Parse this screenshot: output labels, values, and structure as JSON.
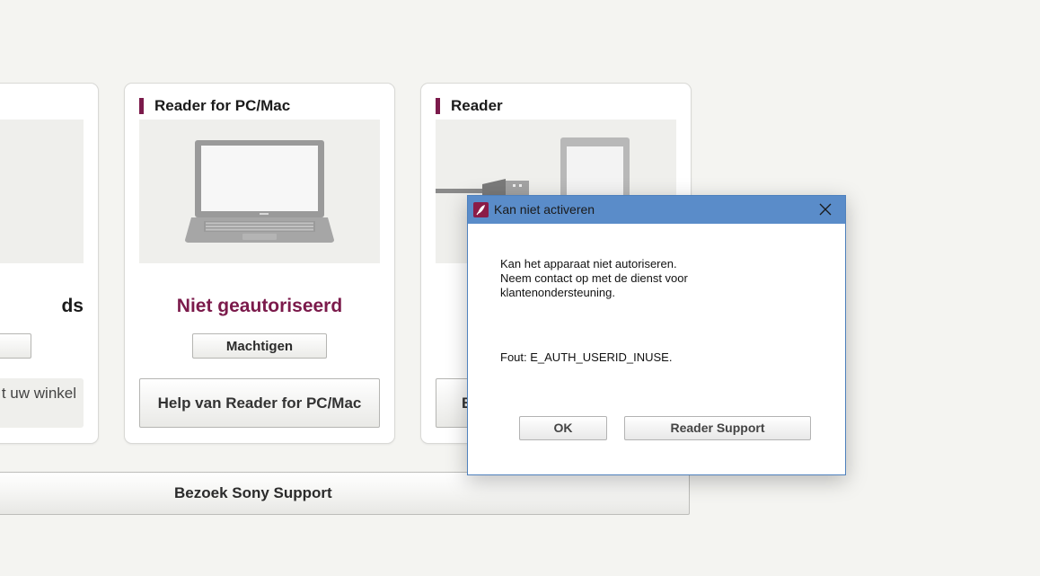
{
  "cards": {
    "store": {
      "status_title": "ds",
      "button_label": "",
      "text": "t uw winkel"
    },
    "pc": {
      "title": "Reader for PC/Mac",
      "status_title": "Niet geautoriseerd",
      "authorize_label": "Machtigen",
      "help_label": "Help van Reader for PC/Mac"
    },
    "reader": {
      "title": "Reader",
      "help_label": "B"
    }
  },
  "support_bar": {
    "label": "Bezoek Sony Support"
  },
  "dialog": {
    "title": "Kan niet activeren",
    "message_lines": [
      "Kan het apparaat niet autoriseren.",
      "Neem contact op met de dienst voor",
      "klantenondersteuning."
    ],
    "error": "Fout: E_AUTH_USERID_INUSE.",
    "ok_label": "OK",
    "support_label": "Reader Support"
  },
  "icons": {
    "app": "reader-app-icon",
    "close": "close-icon",
    "laptop": "laptop-illustration",
    "ereader": "ereader-illustration",
    "bag": "shopping-bag-illustration"
  },
  "colors": {
    "accent": "#7b1a4b",
    "dialog_titlebar": "#5a8cc9",
    "background": "#f4f4f1"
  }
}
